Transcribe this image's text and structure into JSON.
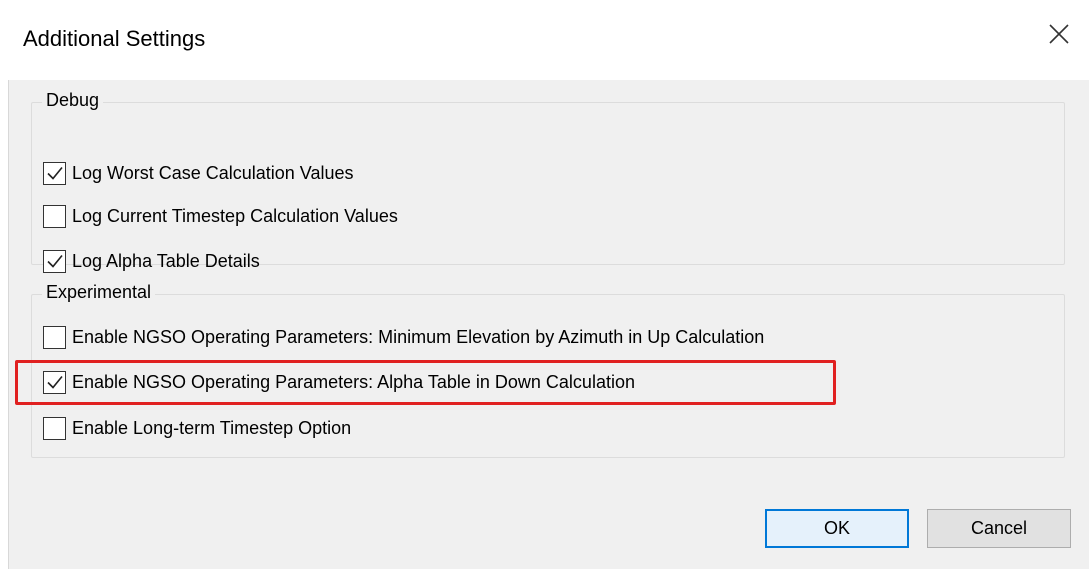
{
  "dialog": {
    "title": "Additional Settings",
    "close_icon": "close-icon"
  },
  "debug": {
    "label": "Debug",
    "options": [
      {
        "label": "Log Worst Case Calculation Values",
        "checked": true
      },
      {
        "label": "Log Current Timestep Calculation Values",
        "checked": false
      },
      {
        "label": "Log Alpha Table Details",
        "checked": true
      }
    ]
  },
  "experimental": {
    "label": "Experimental",
    "options": [
      {
        "label": "Enable NGSO Operating Parameters: Minimum Elevation by Azimuth in Up Calculation",
        "checked": false
      },
      {
        "label": "Enable NGSO Operating Parameters: Alpha Table in Down Calculation",
        "checked": true,
        "highlighted": true
      },
      {
        "label": "Enable Long-term Timestep Option",
        "checked": false
      }
    ]
  },
  "buttons": {
    "ok_label": "OK",
    "cancel_label": "Cancel"
  },
  "colors": {
    "highlight": "#e02020",
    "primary_border": "#0078d7"
  }
}
